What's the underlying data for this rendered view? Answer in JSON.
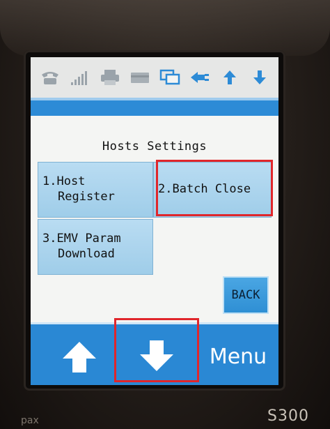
{
  "device": {
    "model": "S300",
    "brand_mark": "pax"
  },
  "status_bar": {
    "icons": [
      "phone-icon",
      "signal-bars-icon",
      "printer-icon",
      "card-reader-icon",
      "screen-copy-icon",
      "ethernet-plug-icon",
      "arrow-up-icon",
      "arrow-down-icon"
    ]
  },
  "screen": {
    "title": "Hosts Settings",
    "options": [
      {
        "line1": "1.Host",
        "line2": "Register"
      },
      {
        "line1": "2.Batch Close"
      },
      {
        "line1": "3.EMV Param",
        "line2": "Download"
      }
    ],
    "back_label": "BACK"
  },
  "bottom_bar": {
    "up_icon": "arrow-up-icon",
    "down_icon": "arrow-down-icon",
    "menu_label": "Menu"
  },
  "colors": {
    "accent_blue": "#2a88d4",
    "button_light_blue": "#a9d4ee",
    "highlight_red": "#e0262b"
  }
}
